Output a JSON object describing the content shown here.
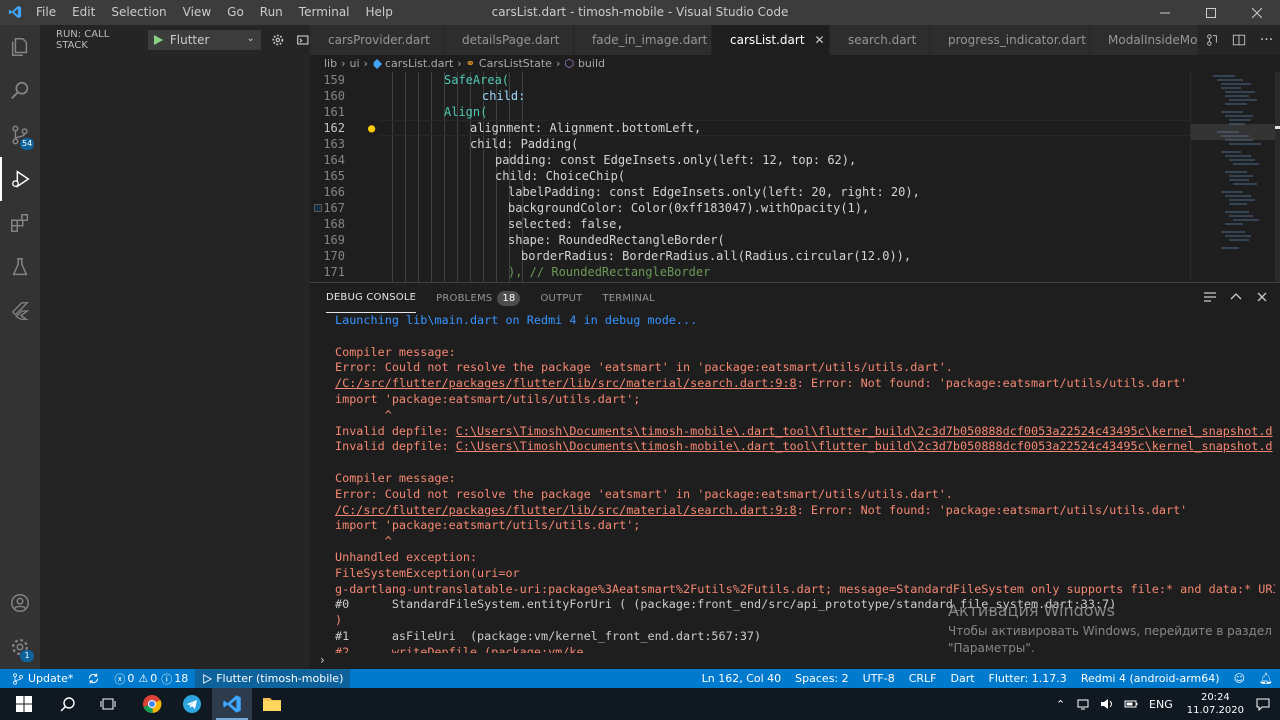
{
  "titlebar": {
    "menus": [
      "File",
      "Edit",
      "Selection",
      "View",
      "Go",
      "Run",
      "Terminal",
      "Help"
    ],
    "title": "carsList.dart - timosh-mobile - Visual Studio Code"
  },
  "activity": {
    "source_control_badge": "54",
    "settings_badge": "1"
  },
  "sidebar": {
    "run_label": "RUN: CALL STACK",
    "config": "Flutter"
  },
  "tabs": [
    {
      "label": "carsProvider.dart"
    },
    {
      "label": "detailsPage.dart"
    },
    {
      "label": "fade_in_image.dart"
    },
    {
      "label": "carsList.dart",
      "active": true
    },
    {
      "label": "search.dart"
    },
    {
      "label": "progress_indicator.dart"
    },
    {
      "label": "ModalInsideModa"
    }
  ],
  "breadcrumbs": [
    "lib",
    "ui",
    "carsList.dart",
    "CarsListState",
    "build"
  ],
  "editor": {
    "lines": [
      {
        "n": "159",
        "code": "SafeArea("
      },
      {
        "n": "160",
        "code": "child:"
      },
      {
        "n": "161",
        "code": "Align("
      },
      {
        "n": "162",
        "code": "alignment: Alignment.bottomLeft,"
      },
      {
        "n": "163",
        "code": "child: Padding("
      },
      {
        "n": "164",
        "code": "padding: const EdgeInsets.only(left: 12, top: 62),"
      },
      {
        "n": "165",
        "code": "child: ChoiceChip("
      },
      {
        "n": "166",
        "code": "labelPadding: const EdgeInsets.only(left: 20, right: 20),"
      },
      {
        "n": "167",
        "code": "backgroundColor: Color(0xff183047).withOpacity(1),"
      },
      {
        "n": "168",
        "code": "selected: false,"
      },
      {
        "n": "169",
        "code": "shape: RoundedRectangleBorder("
      },
      {
        "n": "170",
        "code": "borderRadius: BorderRadius.all(Radius.circular(12.0)),"
      },
      {
        "n": "171",
        "code": "), // RoundedRectangleBorder"
      }
    ]
  },
  "panel": {
    "tabs": {
      "debug_console": "DEBUG CONSOLE",
      "problems": "PROBLEMS",
      "problems_count": "18",
      "output": "OUTPUT",
      "terminal": "TERMINAL"
    },
    "console": [
      {
        "t": "Launching lib\\main.dart on Redmi 4 in debug mode...",
        "c": "blue"
      },
      {
        "t": "",
        "c": "grey"
      },
      {
        "t": "Compiler message:",
        "c": "err"
      },
      {
        "t": "Error: Could not resolve the package 'eatsmart' in 'package:eatsmart/utils/utils.dart'.",
        "c": "err"
      },
      {
        "t": "/C:/src/flutter/packages/flutter/lib/src/material/search.dart:9:8",
        "tail": ": Error: Not found: 'package:eatsmart/utils/utils.dart'",
        "c": "link"
      },
      {
        "t": "import 'package:eatsmart/utils/utils.dart';",
        "c": "err"
      },
      {
        "t": "       ^",
        "c": "err"
      },
      {
        "t": "Invalid depfile: ",
        "link": "C:\\Users\\Timosh\\Documents\\timosh-mobile\\.dart_tool\\flutter_build\\2c3d7b050888dcf0053a22524c43495c\\kernel_snapshot.d",
        "c": "pre"
      },
      {
        "t": "Invalid depfile: ",
        "link": "C:\\Users\\Timosh\\Documents\\timosh-mobile\\.dart_tool\\flutter_build\\2c3d7b050888dcf0053a22524c43495c\\kernel_snapshot.d",
        "c": "pre"
      },
      {
        "t": "",
        "c": "grey"
      },
      {
        "t": "Compiler message:",
        "c": "err"
      },
      {
        "t": "Error: Could not resolve the package 'eatsmart' in 'package:eatsmart/utils/utils.dart'.",
        "c": "err"
      },
      {
        "t": "/C:/src/flutter/packages/flutter/lib/src/material/search.dart:9:8",
        "tail": ": Error: Not found: 'package:eatsmart/utils/utils.dart'",
        "c": "link"
      },
      {
        "t": "import 'package:eatsmart/utils/utils.dart';",
        "c": "err"
      },
      {
        "t": "       ^",
        "c": "err"
      },
      {
        "t": "Unhandled exception:",
        "c": "err"
      },
      {
        "t": "FileSystemException(uri=or",
        "c": "err"
      },
      {
        "t": "g-dartlang-untranslatable-uri:package%3Aeatsmart%2Futils%2Futils.dart; message=StandardFileSystem only supports file:* and data:* URIs)",
        "c": "err"
      },
      {
        "t": "#0      StandardFileSystem.entityForUri ( (package:front_end/src/api_prototype/standard_file_system.dart:33:7)",
        "c": "grey"
      },
      {
        "t": ")",
        "c": "err"
      },
      {
        "t": "#1      asFileUri  (package:vm/kernel_front_end.dart:567:37)",
        "c": "grey"
      },
      {
        "t": "#2      writeDepfile (package:vm/ke",
        "c": "err"
      }
    ]
  },
  "watermark": {
    "title": "Активация Windows",
    "line1": "Чтобы активировать Windows, перейдите в раздел",
    "line2": "\"Параметры\"."
  },
  "status": {
    "update": "Update*",
    "errors": "0",
    "warnings": "0",
    "info": "18",
    "debug": "Flutter (timosh-mobile)",
    "position": "Ln 162, Col 40",
    "spaces": "Spaces: 2",
    "encoding": "UTF-8",
    "eol": "CRLF",
    "language": "Dart",
    "flutter": "Flutter: 1.17.3",
    "device": "Redmi 4 (android-arm64)"
  },
  "taskbar": {
    "lang": "ENG",
    "time": "20:24",
    "date": "11.07.2020"
  }
}
